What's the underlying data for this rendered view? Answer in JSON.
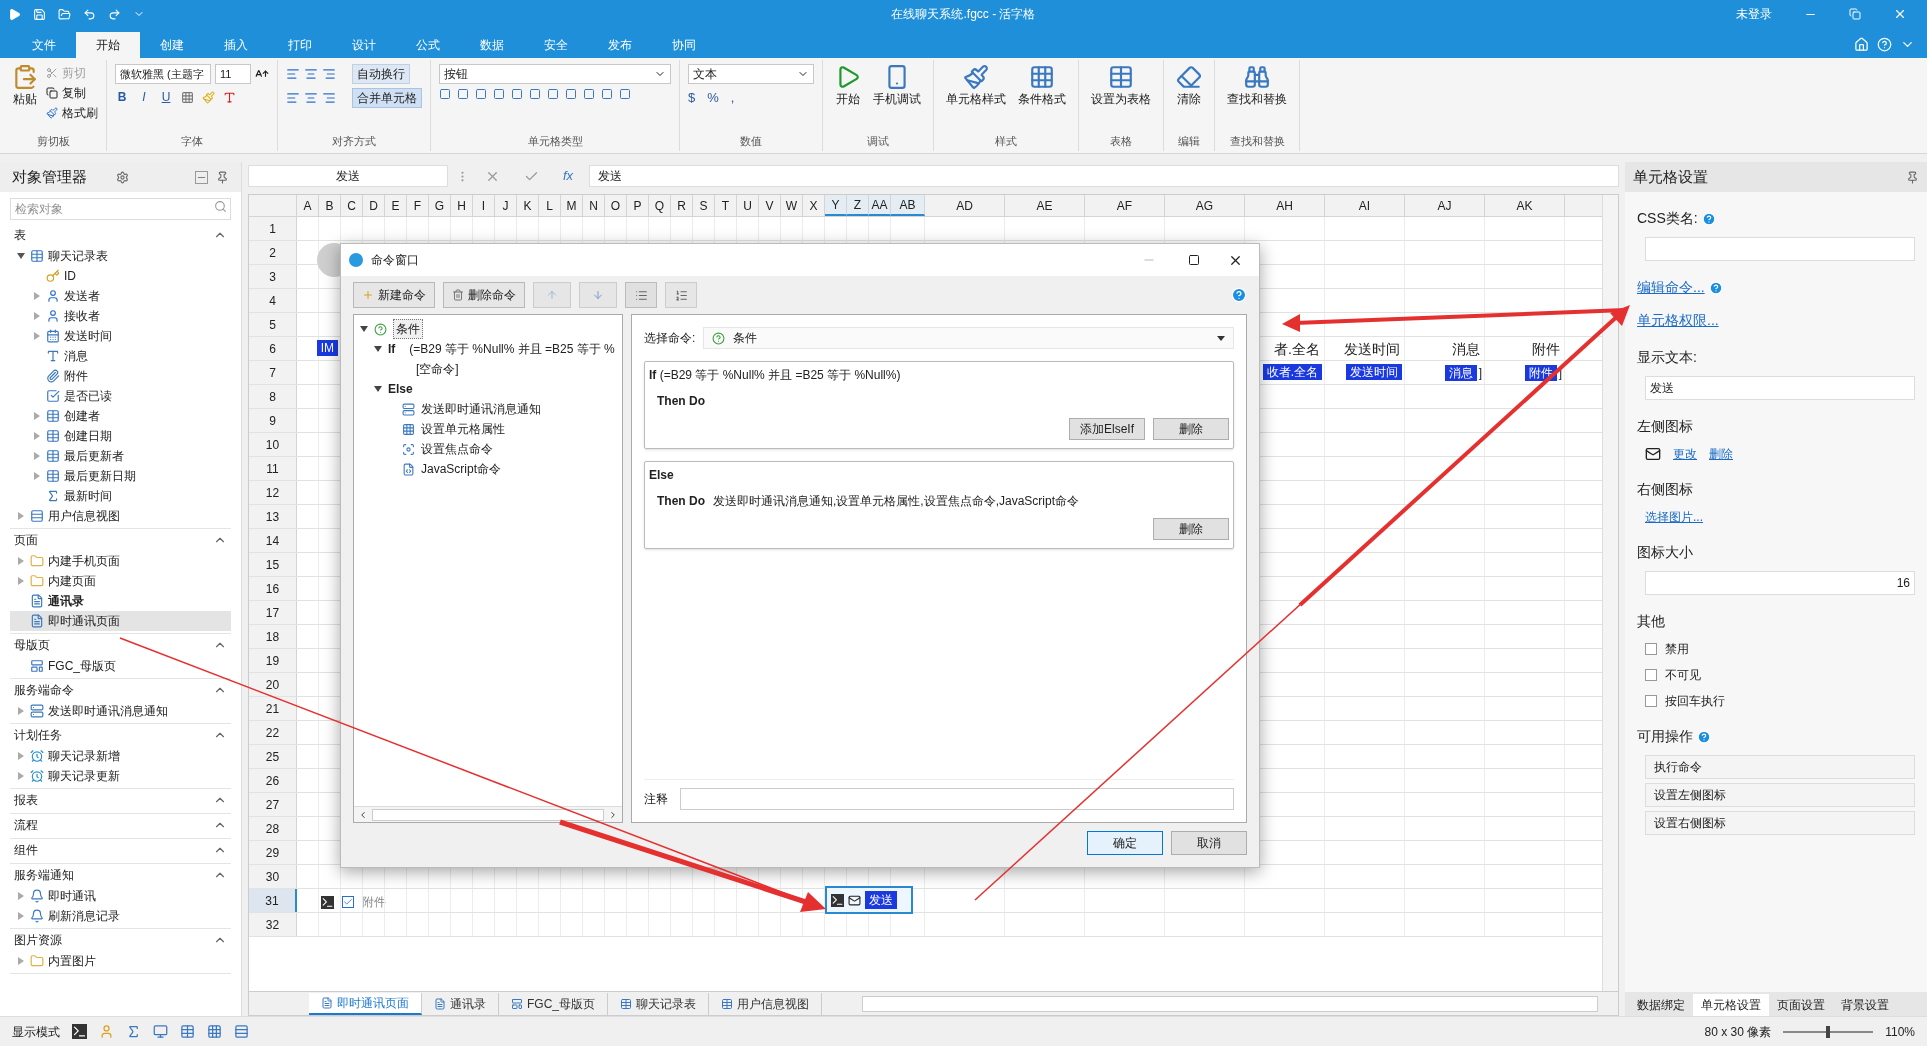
{
  "window": {
    "title": "在线聊天系统.fgcc - 活字格",
    "user": "未登录"
  },
  "menu_tabs": [
    {
      "label": "文件",
      "selected": false
    },
    {
      "label": "开始",
      "selected": true
    },
    {
      "label": "创建",
      "selected": false
    },
    {
      "label": "插入",
      "selected": false
    },
    {
      "label": "打印",
      "selected": false
    },
    {
      "label": "设计",
      "selected": false
    },
    {
      "label": "公式",
      "selected": false
    },
    {
      "label": "数据",
      "selected": false
    },
    {
      "label": "安全",
      "selected": false
    },
    {
      "label": "发布",
      "selected": false
    },
    {
      "label": "协同",
      "selected": false
    }
  ],
  "ribbon": [
    {
      "kind": "clipboard",
      "label": "剪切板",
      "big": "粘贴",
      "small": [
        {
          "label": "剪切",
          "disabled": true
        },
        {
          "label": "复制",
          "disabled": false
        },
        {
          "label": "格式刷",
          "disabled": false
        }
      ]
    },
    {
      "kind": "font",
      "label": "字体",
      "font": "微软雅黑 (主题字",
      "size": "11",
      "styles": [
        "B",
        "I",
        "U"
      ]
    },
    {
      "kind": "align",
      "label": "对齐方式",
      "wrap": "自动换行",
      "merge": "合并单元格"
    },
    {
      "kind": "celltype",
      "label": "单元格类型",
      "type": "按钮"
    },
    {
      "kind": "number",
      "label": "数值",
      "format": "文本",
      "symbols": [
        "$",
        "%",
        ","
      ]
    },
    {
      "kind": "debug",
      "label": "调试",
      "buttons": [
        "开始",
        "手机调试"
      ]
    },
    {
      "kind": "style",
      "label": "样式",
      "buttons": [
        "单元格样式",
        "条件格式"
      ]
    },
    {
      "kind": "table",
      "label": "表格",
      "buttons": [
        "设置为表格"
      ]
    },
    {
      "kind": "edit",
      "label": "编辑",
      "buttons": [
        "清除"
      ]
    },
    {
      "kind": "find",
      "label": "查找和替换",
      "buttons": [
        "查找和替换"
      ]
    }
  ],
  "object_manager": {
    "title": "对象管理器",
    "search_placeholder": "检索对象",
    "sections": [
      {
        "title": "表",
        "items": [
          {
            "label": "聊天记录表",
            "kind": "table",
            "expanded": true,
            "selected": false,
            "children": [
              {
                "label": "ID",
                "kind": "key",
                "selected": false
              },
              {
                "label": "发送者",
                "kind": "user",
                "expanded": false,
                "selected": false
              },
              {
                "label": "接收者",
                "kind": "user",
                "expanded": false,
                "selected": false
              },
              {
                "label": "发送时间",
                "kind": "calendar",
                "expanded": false,
                "selected": false
              },
              {
                "label": "消息",
                "kind": "text",
                "selected": false
              },
              {
                "label": "附件",
                "kind": "attachment",
                "selected": false
              },
              {
                "label": "是否已读",
                "kind": "check",
                "selected": false
              },
              {
                "label": "创建者",
                "kind": "table",
                "expanded": false,
                "selected": false
              },
              {
                "label": "创建日期",
                "kind": "table",
                "expanded": false,
                "selected": false
              },
              {
                "label": "最后更新者",
                "kind": "table",
                "expanded": false,
                "selected": false
              },
              {
                "label": "最后更新日期",
                "kind": "table",
                "expanded": false,
                "selected": false
              },
              {
                "label": "最新时间",
                "kind": "sum",
                "selected": false
              }
            ]
          },
          {
            "label": "用户信息视图",
            "kind": "view",
            "expanded": false,
            "selected": false
          }
        ]
      },
      {
        "title": "页面",
        "items": [
          {
            "label": "内建手机页面",
            "kind": "folder",
            "expanded": false,
            "selected": false,
            "bold": false
          },
          {
            "label": "内建页面",
            "kind": "folder",
            "expanded": false,
            "selected": false,
            "bold": false
          },
          {
            "label": "通讯录",
            "kind": "page",
            "selected": false,
            "bold": true
          },
          {
            "label": "即时通讯页面",
            "kind": "page",
            "selected": true,
            "bold": false
          }
        ]
      },
      {
        "title": "母版页",
        "items": [
          {
            "label": "FGC_母版页",
            "kind": "master",
            "selected": false
          }
        ]
      },
      {
        "title": "服务端命令",
        "items": [
          {
            "label": "发送即时通讯消息通知",
            "kind": "server",
            "expanded": false,
            "selected": false
          }
        ]
      },
      {
        "title": "计划任务",
        "items": [
          {
            "label": "聊天记录新增",
            "kind": "task",
            "expanded": false,
            "selected": false
          },
          {
            "label": "聊天记录更新",
            "kind": "task",
            "expanded": false,
            "selected": false
          }
        ]
      },
      {
        "title": "报表"
      },
      {
        "title": "流程"
      },
      {
        "title": "组件"
      },
      {
        "title": "服务端通知",
        "items": [
          {
            "label": "即时通讯",
            "kind": "notify",
            "expanded": false,
            "selected": false
          },
          {
            "label": "刷新消息记录",
            "kind": "notify",
            "expanded": false,
            "selected": false
          }
        ]
      },
      {
        "title": "图片资源",
        "items": [
          {
            "label": "内置图片",
            "kind": "folder",
            "expanded": false,
            "selected": false
          }
        ]
      }
    ]
  },
  "formula_bar": {
    "name_box": "发送",
    "fx": "fx",
    "value": "发送"
  },
  "sheet": {
    "columns": [
      {
        "label": "A",
        "selected": false
      },
      {
        "label": "B",
        "selected": false
      },
      {
        "label": "C",
        "selected": false
      },
      {
        "label": "D",
        "selected": false
      },
      {
        "label": "E",
        "selected": false
      },
      {
        "label": "F",
        "selected": false
      },
      {
        "label": "G",
        "selected": false
      },
      {
        "label": "H",
        "selected": false
      },
      {
        "label": "I",
        "selected": false
      },
      {
        "label": "J",
        "selected": false
      },
      {
        "label": "K",
        "selected": false
      },
      {
        "label": "L",
        "selected": false
      },
      {
        "label": "M",
        "selected": false
      },
      {
        "label": "N",
        "selected": false
      },
      {
        "label": "O",
        "selected": false
      },
      {
        "label": "P",
        "selected": false
      },
      {
        "label": "Q",
        "selected": false
      },
      {
        "label": "R",
        "selected": false
      },
      {
        "label": "S",
        "selected": false
      },
      {
        "label": "T",
        "selected": false
      },
      {
        "label": "U",
        "selected": false
      },
      {
        "label": "V",
        "selected": false
      },
      {
        "label": "W",
        "selected": false
      },
      {
        "label": "X",
        "selected": false
      },
      {
        "label": "Y",
        "selected": true
      },
      {
        "label": "Z",
        "selected": true
      },
      {
        "label": "AA",
        "selected": true
      },
      {
        "label": "AB",
        "selected": true
      },
      {
        "label": "AD",
        "selected": false
      },
      {
        "label": "AE",
        "selected": false
      },
      {
        "label": "AF",
        "selected": false
      },
      {
        "label": "AG",
        "selected": false
      },
      {
        "label": "AH",
        "selected": false
      },
      {
        "label": "AI",
        "selected": false
      },
      {
        "label": "AJ",
        "selected": false
      },
      {
        "label": "AK",
        "selected": false
      }
    ],
    "rows": [
      {
        "number": "1",
        "selected": false
      },
      {
        "number": "2",
        "selected": false,
        "cells": [
          "",
          {
            "kind": "avatar"
          }
        ]
      },
      {
        "number": "3",
        "selected": false
      },
      {
        "number": "4",
        "selected": false
      },
      {
        "number": "5",
        "selected": false
      },
      {
        "number": "6",
        "selected": false,
        "cells": [
          "",
          {
            "kind": "chip",
            "text": "IM"
          },
          "",
          "",
          "",
          "",
          "",
          "",
          "",
          "",
          "",
          "",
          "",
          "",
          "",
          "",
          "",
          "",
          "",
          "",
          "",
          "",
          "",
          "",
          "",
          "",
          "",
          "",
          "",
          "",
          "",
          "",
          {
            "kind": "text",
            "text": "者.全名"
          },
          {
            "kind": "text",
            "text": "发送时间"
          },
          {
            "kind": "text",
            "text": "消息"
          },
          {
            "kind": "text",
            "text": "附件"
          }
        ]
      },
      {
        "number": "7",
        "selected": false,
        "cells": [
          "",
          "",
          "",
          "",
          "",
          "",
          "",
          "",
          "",
          "",
          "",
          "",
          "",
          "",
          "",
          "",
          "",
          "",
          "",
          "",
          "",
          "",
          "",
          "",
          "",
          "",
          "",
          "",
          "",
          "",
          "",
          "",
          {
            "kind": "chip",
            "text": "收者.全名"
          },
          {
            "kind": "chip",
            "text": "发送时间"
          },
          {
            "kind": "chip",
            "text": "消息",
            "suffix": "]"
          },
          {
            "kind": "chip",
            "text": "附件",
            "suffix": "]"
          }
        ]
      },
      {
        "number": "8",
        "selected": false
      },
      {
        "number": "9",
        "selected": false
      },
      {
        "number": "10",
        "selected": false
      },
      {
        "number": "11",
        "selected": false
      },
      {
        "number": "12",
        "selected": false
      },
      {
        "number": "13",
        "selected": false
      },
      {
        "number": "14",
        "selected": false
      },
      {
        "number": "15",
        "selected": false
      },
      {
        "number": "16",
        "selected": false
      },
      {
        "number": "17",
        "selected": false
      },
      {
        "number": "18",
        "selected": false
      },
      {
        "number": "19",
        "selected": false
      },
      {
        "number": "20",
        "selected": false
      },
      {
        "number": "21",
        "selected": false
      },
      {
        "number": "22",
        "selected": false
      },
      {
        "number": "25",
        "selected": false
      },
      {
        "number": "26",
        "selected": false
      },
      {
        "number": "27",
        "selected": false
      },
      {
        "number": "28",
        "selected": false
      },
      {
        "number": "29",
        "selected": false
      },
      {
        "number": "30",
        "selected": false
      },
      {
        "number": "31",
        "selected": true,
        "cells": [
          "",
          {
            "kind": "checkbox",
            "text": "附件"
          },
          "",
          "",
          "",
          "",
          "",
          "",
          "",
          "",
          "",
          "",
          "",
          "",
          "",
          "",
          "",
          "",
          "",
          "",
          "",
          "",
          "",
          "",
          {
            "kind": "button",
            "text": "发送",
            "selected": true
          }
        ]
      },
      {
        "number": "32",
        "selected": false
      }
    ]
  },
  "sheet_tabs": [
    {
      "label": "即时通讯页面",
      "kind": "page",
      "selected": true
    },
    {
      "label": "通讯录",
      "kind": "page",
      "selected": false
    },
    {
      "label": "FGC_母版页",
      "kind": "master",
      "selected": false
    },
    {
      "label": "聊天记录表",
      "kind": "table",
      "selected": false
    },
    {
      "label": "用户信息视图",
      "kind": "table",
      "selected": false
    }
  ],
  "dialog": {
    "title": "命令窗口",
    "toolbar": [
      "新建命令",
      "删除命令"
    ],
    "tree": [
      {
        "label": "条件",
        "kind": "condition",
        "expanded": true,
        "selected": true,
        "children": [
          {
            "label": "If",
            "kind": "branch",
            "detail": "(=B29 等于 %Null% 并且 =B25 等于 %",
            "expanded": true,
            "selected": false,
            "children": [
              {
                "label": "[空命令]",
                "kind": "empty",
                "selected": false
              }
            ]
          },
          {
            "label": "Else",
            "kind": "branch",
            "expanded": true,
            "selected": false,
            "children": [
              {
                "label": "发送即时通讯消息通知",
                "kind": "server",
                "selected": false
              },
              {
                "label": "设置单元格属性",
                "kind": "cell",
                "selected": false
              },
              {
                "label": "设置焦点命令",
                "kind": "focus",
                "selected": false
              },
              {
                "label": "JavaScript命令",
                "kind": "script",
                "selected": false
              }
            ]
          }
        ]
      }
    ],
    "select_label": "选择命令:",
    "select_value": "条件",
    "blocks": [
      {
        "header": "**If** (=B29 等于 %Null% 并且 =B25 等于 %Null%)",
        "then_label": "Then Do",
        "buttons": [
          "添加ElseIf",
          "删除"
        ]
      },
      {
        "header": "**Else**",
        "then_label": "Then Do",
        "then_text": "发送即时通讯消息通知,设置单元格属性,设置焦点命令,JavaScript命令",
        "buttons": [
          "删除"
        ]
      }
    ],
    "note_label": "注释",
    "buttons": [
      {
        "label": "确定",
        "selected": true
      },
      {
        "label": "取消",
        "selected": false
      }
    ]
  },
  "cell_settings": {
    "title": "单元格设置",
    "css_label": "CSS类名:",
    "links": [
      "编辑命令...",
      "单元格权限..."
    ],
    "display_text_label": "显示文本:",
    "display_text": "发送",
    "left_icon_label": "左侧图标",
    "left_icon_links": [
      "更改",
      "删除"
    ],
    "right_icon_label": "右侧图标",
    "right_icon_link": "选择图片...",
    "icon_size_label": "图标大小",
    "icon_size": "16",
    "other_label": "其他",
    "checkboxes": [
      {
        "label": "禁用",
        "checked": false
      },
      {
        "label": "不可见",
        "checked": false
      },
      {
        "label": "按回车执行",
        "checked": false
      }
    ],
    "actions_label": "可用操作",
    "actions": [
      "执行命令",
      "设置左侧图标",
      "设置右侧图标"
    ],
    "tabs": [
      {
        "label": "数据绑定",
        "selected": false
      },
      {
        "label": "单元格设置",
        "selected": true
      },
      {
        "label": "页面设置",
        "selected": false
      },
      {
        "label": "背景设置",
        "selected": false
      }
    ]
  },
  "status_bar": {
    "mode_label": "显示模式",
    "size": "80 x 30 像素",
    "zoom_slider": {
      "level": 0.5
    },
    "zoom": "110%"
  }
}
